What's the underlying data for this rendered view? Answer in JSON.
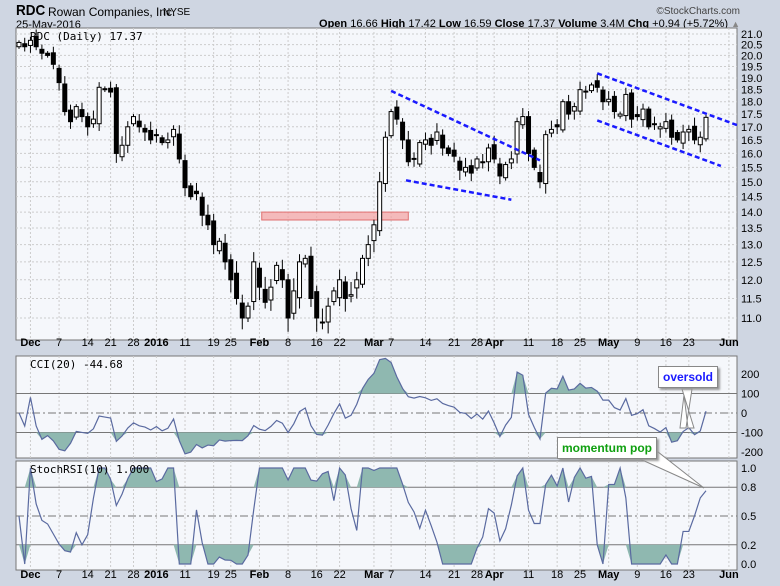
{
  "header": {
    "symbol": "RDC",
    "company": "Rowan Companies, Inc.",
    "exchange": "NYSE",
    "date": "25-May-2016",
    "brand": "©StockCharts.com",
    "open_label": "Open",
    "open": "16.66",
    "high_label": "High",
    "high": "17.42",
    "low_label": "Low",
    "low": "16.59",
    "close_label": "Close",
    "close": "17.37",
    "volume_label": "Volume",
    "volume": "3.4M",
    "chg_label": "Chg",
    "chg": "+0.94 (+5.72%)"
  },
  "colors": {
    "bg": "#f5f7fb",
    "frame": "#cfd6e2",
    "fill": "#8fb8b0",
    "line": "#5a6aa0",
    "trend": "#1a1aff",
    "zone": "#f4a0a0",
    "oversold": "#1a1aff",
    "pop": "#10a010"
  },
  "annotations": {
    "oversold": "oversold",
    "momentum_pop": "momentum pop"
  },
  "chart_data": [
    {
      "type": "candlestick",
      "title": "RDC (Daily) 17.37",
      "scale": "log",
      "ylim": [
        10.6,
        21.2
      ],
      "yticks": [
        11.0,
        11.5,
        12.0,
        12.5,
        13.0,
        13.5,
        14.0,
        14.5,
        15.0,
        15.5,
        16.0,
        16.5,
        17.0,
        17.5,
        18.0,
        18.5,
        19.0,
        19.5,
        20.0,
        20.5,
        21.0
      ],
      "xticks": [
        {
          "l": "Dec",
          "i": 2,
          "b": 1
        },
        {
          "l": "7",
          "i": 7
        },
        {
          "l": "14",
          "i": 12
        },
        {
          "l": "21",
          "i": 16
        },
        {
          "l": "28",
          "i": 20
        },
        {
          "l": "2016",
          "i": 24,
          "b": 1
        },
        {
          "l": "11",
          "i": 29
        },
        {
          "l": "19",
          "i": 34
        },
        {
          "l": "25",
          "i": 37
        },
        {
          "l": "Feb",
          "i": 42,
          "b": 1
        },
        {
          "l": "8",
          "i": 47
        },
        {
          "l": "16",
          "i": 52
        },
        {
          "l": "22",
          "i": 56
        },
        {
          "l": "Mar",
          "i": 62,
          "b": 1
        },
        {
          "l": "7",
          "i": 65
        },
        {
          "l": "14",
          "i": 71
        },
        {
          "l": "21",
          "i": 76
        },
        {
          "l": "28",
          "i": 80
        },
        {
          "l": "Apr",
          "i": 83,
          "b": 1
        },
        {
          "l": "11",
          "i": 89
        },
        {
          "l": "18",
          "i": 94
        },
        {
          "l": "25",
          "i": 98
        },
        {
          "l": "May",
          "i": 103,
          "b": 1
        },
        {
          "l": "9",
          "i": 108
        },
        {
          "l": "16",
          "i": 113
        },
        {
          "l": "23",
          "i": 117
        },
        {
          "l": "Jun",
          "i": 124,
          "b": 1
        }
      ],
      "closes": [
        20.6,
        20.4,
        20.7,
        20.4,
        20.1,
        20.0,
        19.6,
        18.8,
        17.6,
        17.2,
        17.8,
        17.4,
        17.0,
        17.3,
        18.6,
        18.5,
        18.4,
        16.0,
        16.3,
        17.0,
        17.4,
        17.0,
        16.8,
        16.5,
        16.7,
        16.4,
        16.5,
        16.9,
        15.8,
        14.8,
        14.5,
        14.6,
        13.9,
        13.6,
        13.0,
        13.1,
        12.5,
        12.0,
        11.5,
        11.0,
        11.3,
        12.5,
        11.8,
        11.4,
        11.8,
        12.4,
        12.0,
        11.0,
        11.7,
        12.5,
        12.6,
        11.5,
        11.0,
        10.9,
        11.3,
        11.7,
        12.0,
        11.5,
        11.6,
        12.0,
        12.6,
        13.0,
        13.6,
        15.0,
        16.6,
        17.6,
        17.3,
        16.5,
        15.7,
        15.8,
        16.4,
        16.5,
        16.3,
        16.8,
        16.2,
        16.0,
        15.9,
        15.4,
        15.5,
        15.3,
        15.8,
        15.7,
        16.2,
        15.8,
        15.2,
        15.6,
        15.8,
        17.2,
        17.4,
        16.0,
        15.5,
        15.0,
        16.7,
        16.9,
        17.0,
        18.0,
        17.5,
        17.8,
        18.5,
        18.4,
        18.7,
        18.6,
        18.0,
        18.1,
        17.6,
        17.5,
        18.3,
        17.3,
        17.4,
        17.7,
        17.0,
        17.1,
        17.0,
        17.2,
        16.6,
        16.5,
        16.8,
        16.9,
        16.5,
        16.6,
        17.37
      ],
      "trendlines": [
        {
          "i0": 65,
          "p0": 18.45,
          "i1": 91,
          "p1": 15.75
        },
        {
          "i0": 67.6,
          "p0": 15.05,
          "i1": 86,
          "p1": 14.4
        },
        {
          "i0": 101,
          "p0": 19.2,
          "i1": 125.6,
          "p1": 17.05
        },
        {
          "i0": 101,
          "p0": 17.25,
          "i1": 122.6,
          "p1": 15.55
        }
      ],
      "resistance_zone": {
        "i0": 42.4,
        "i1": 68,
        "low": 13.75,
        "high": 14.0
      }
    },
    {
      "type": "line",
      "title": "CCI(20) -44.68",
      "period": 20,
      "ylim": [
        -250,
        300
      ],
      "yticks": [
        200,
        100,
        0,
        -100,
        -200
      ],
      "levels": [
        100,
        -100
      ]
    },
    {
      "type": "line",
      "title": "StochRSI(10) 1.000",
      "period": 10,
      "ylim": [
        -0.05,
        1.05
      ],
      "yticks": [
        1.0,
        0.8,
        0.5,
        0.2,
        0.0
      ],
      "levels": [
        0.8,
        0.2
      ]
    }
  ]
}
